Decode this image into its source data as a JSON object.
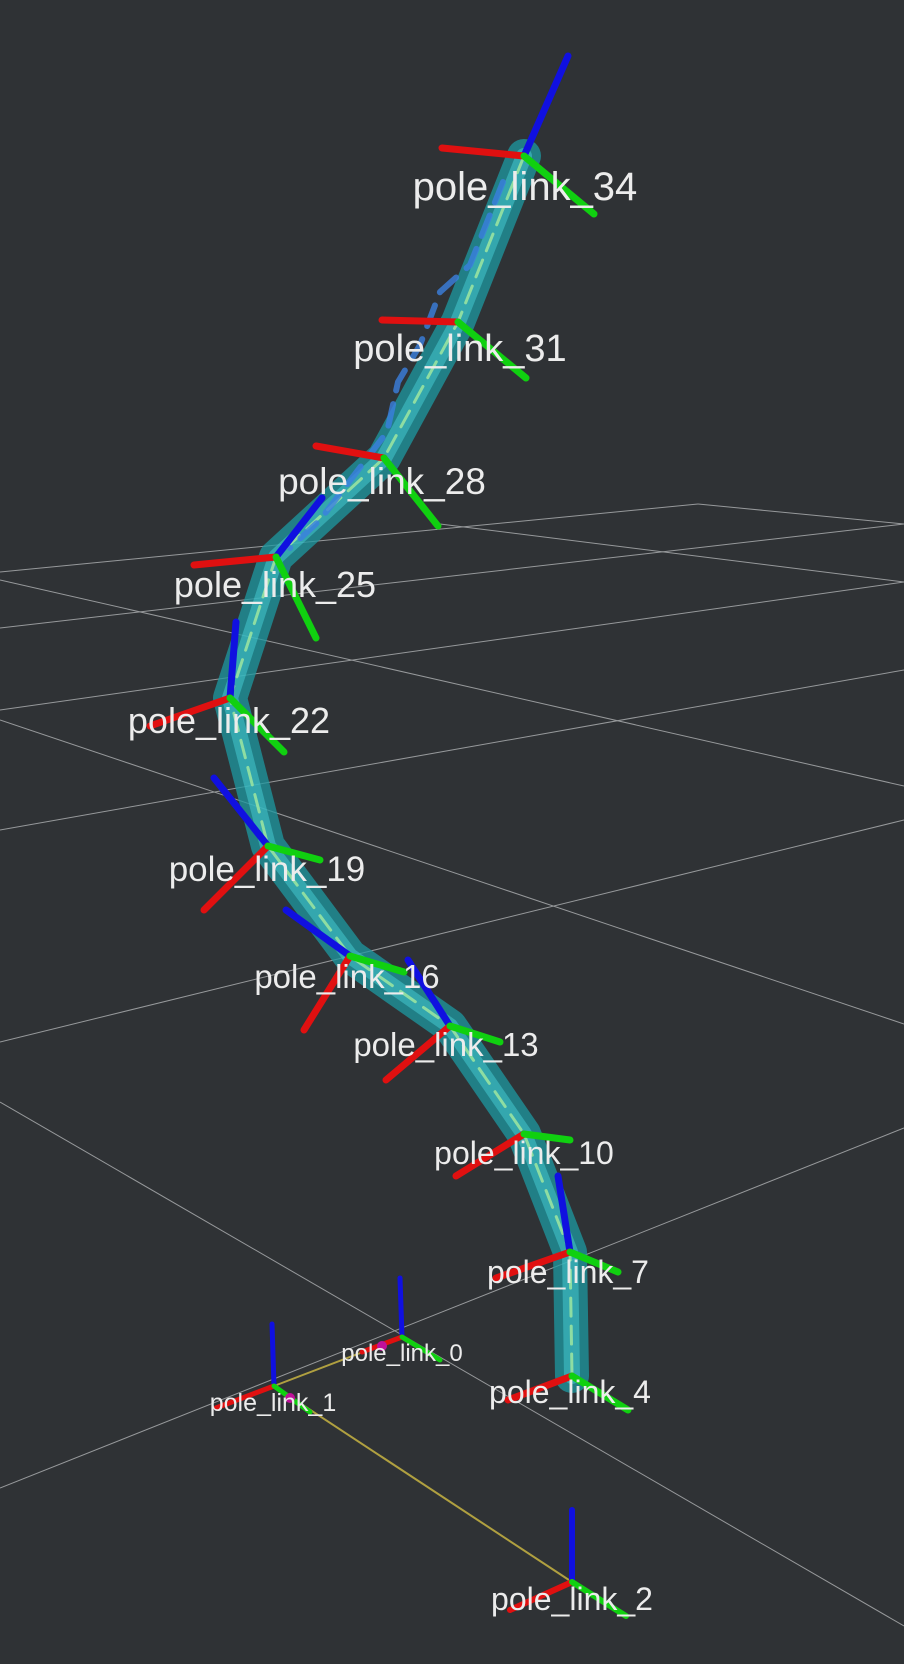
{
  "view": {
    "background": "#2f3235",
    "grid_color": "#a9abad",
    "axis_colors": {
      "x": "#e01010",
      "y": "#10d010",
      "z": "#1010e0"
    },
    "link_color": "#2ab0b8",
    "parent_line_color": "#b0a040"
  },
  "frames": [
    {
      "id": "pole_link_34",
      "label": "pole_link_34"
    },
    {
      "id": "pole_link_31",
      "label": "pole_link_31"
    },
    {
      "id": "pole_link_28",
      "label": "pole_link_28"
    },
    {
      "id": "pole_link_25",
      "label": "pole_link_25"
    },
    {
      "id": "pole_link_22",
      "label": "pole_link_22"
    },
    {
      "id": "pole_link_19",
      "label": "pole_link_19"
    },
    {
      "id": "pole_link_16",
      "label": "pole_link_16"
    },
    {
      "id": "pole_link_13",
      "label": "pole_link_13"
    },
    {
      "id": "pole_link_10",
      "label": "pole_link_10"
    },
    {
      "id": "pole_link_7",
      "label": "pole_link_7"
    },
    {
      "id": "pole_link_4",
      "label": "pole_link_4"
    },
    {
      "id": "pole_link_0",
      "label": "pole_link_0"
    },
    {
      "id": "pole_link_1",
      "label": "pole_link_1"
    },
    {
      "id": "pole_link_2",
      "label": "pole_link_2"
    }
  ]
}
